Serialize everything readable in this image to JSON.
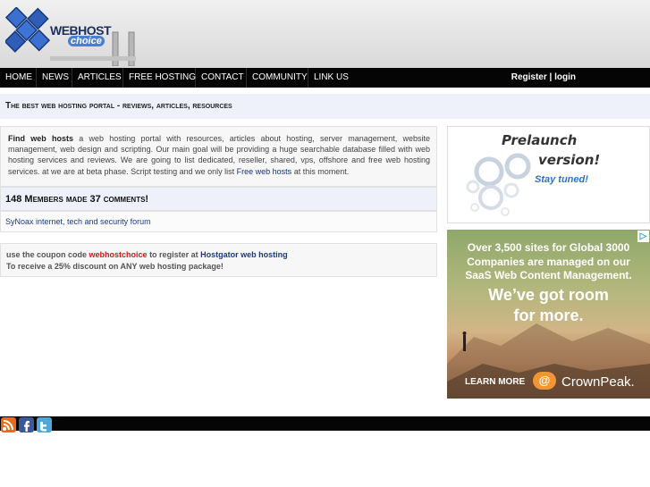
{
  "logo": {
    "text_top": "WEBHOST",
    "text_bottom": "choice"
  },
  "nav": {
    "items": [
      "HOME",
      "NEWS",
      "ARTICLES",
      "FREE HOSTING",
      "CONTACT",
      "COMMUNITY",
      "LINK US"
    ],
    "register": "Register",
    "separator": "|",
    "login": "login"
  },
  "tagline": "The best web hosting portal - reviews, articles, resources",
  "intro": {
    "lead": "Find web hosts",
    "body": "a web hosting portal with resources, articles about hosting, server management, website management, web design and scripting. Our main goal will be providing a huge searchable database filled with web hosting services and reviews. We are going to list dedicated, reseller, shared, vps, offshore and free web hosting services. at we are at beta phase. Script testing and we only list",
    "link": "Free web hosts",
    "tail": "at this moment."
  },
  "members": {
    "text": "148 Members made 37 comments!"
  },
  "forum_link": "SyNoax internet, tech and security forum",
  "coupon": {
    "prefix": "use the coupon code",
    "code": "webhostchoice",
    "middle": "to register at",
    "link": "Hostgator web hosting",
    "line2": "To receive a 25% discount on ANY web hosting package!"
  },
  "prelaunch": {
    "title1": "Prelaunch",
    "title2": "version!",
    "subtitle": "Stay tuned!"
  },
  "ad": {
    "headline": "Over 3,500 sites for Global 3000 Companies are managed on our SaaS Web Content Management.",
    "big": "We’ve got room for more.",
    "cta": "LEARN MORE",
    "at_symbol": "@",
    "brand": "CrownPeak.",
    "choice_icon": "▷"
  },
  "colors": {
    "nav_bg": "#050505",
    "tagline_bg": "#eef0fa",
    "coupon_code": "#d8141c",
    "link": "#1a3a88"
  }
}
